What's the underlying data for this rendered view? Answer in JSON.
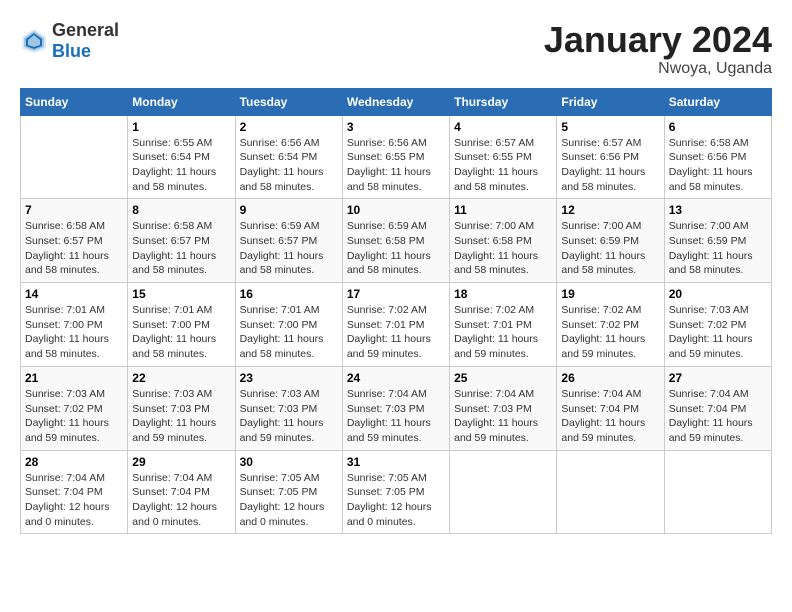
{
  "logo": {
    "general": "General",
    "blue": "Blue"
  },
  "header": {
    "month": "January 2024",
    "location": "Nwoya, Uganda"
  },
  "weekdays": [
    "Sunday",
    "Monday",
    "Tuesday",
    "Wednesday",
    "Thursday",
    "Friday",
    "Saturday"
  ],
  "weeks": [
    [
      {
        "day": "",
        "sunrise": "",
        "sunset": "",
        "daylight": ""
      },
      {
        "day": "1",
        "sunrise": "Sunrise: 6:55 AM",
        "sunset": "Sunset: 6:54 PM",
        "daylight": "Daylight: 11 hours and 58 minutes."
      },
      {
        "day": "2",
        "sunrise": "Sunrise: 6:56 AM",
        "sunset": "Sunset: 6:54 PM",
        "daylight": "Daylight: 11 hours and 58 minutes."
      },
      {
        "day": "3",
        "sunrise": "Sunrise: 6:56 AM",
        "sunset": "Sunset: 6:55 PM",
        "daylight": "Daylight: 11 hours and 58 minutes."
      },
      {
        "day": "4",
        "sunrise": "Sunrise: 6:57 AM",
        "sunset": "Sunset: 6:55 PM",
        "daylight": "Daylight: 11 hours and 58 minutes."
      },
      {
        "day": "5",
        "sunrise": "Sunrise: 6:57 AM",
        "sunset": "Sunset: 6:56 PM",
        "daylight": "Daylight: 11 hours and 58 minutes."
      },
      {
        "day": "6",
        "sunrise": "Sunrise: 6:58 AM",
        "sunset": "Sunset: 6:56 PM",
        "daylight": "Daylight: 11 hours and 58 minutes."
      }
    ],
    [
      {
        "day": "7",
        "sunrise": "Sunrise: 6:58 AM",
        "sunset": "Sunset: 6:57 PM",
        "daylight": "Daylight: 11 hours and 58 minutes."
      },
      {
        "day": "8",
        "sunrise": "Sunrise: 6:58 AM",
        "sunset": "Sunset: 6:57 PM",
        "daylight": "Daylight: 11 hours and 58 minutes."
      },
      {
        "day": "9",
        "sunrise": "Sunrise: 6:59 AM",
        "sunset": "Sunset: 6:57 PM",
        "daylight": "Daylight: 11 hours and 58 minutes."
      },
      {
        "day": "10",
        "sunrise": "Sunrise: 6:59 AM",
        "sunset": "Sunset: 6:58 PM",
        "daylight": "Daylight: 11 hours and 58 minutes."
      },
      {
        "day": "11",
        "sunrise": "Sunrise: 7:00 AM",
        "sunset": "Sunset: 6:58 PM",
        "daylight": "Daylight: 11 hours and 58 minutes."
      },
      {
        "day": "12",
        "sunrise": "Sunrise: 7:00 AM",
        "sunset": "Sunset: 6:59 PM",
        "daylight": "Daylight: 11 hours and 58 minutes."
      },
      {
        "day": "13",
        "sunrise": "Sunrise: 7:00 AM",
        "sunset": "Sunset: 6:59 PM",
        "daylight": "Daylight: 11 hours and 58 minutes."
      }
    ],
    [
      {
        "day": "14",
        "sunrise": "Sunrise: 7:01 AM",
        "sunset": "Sunset: 7:00 PM",
        "daylight": "Daylight: 11 hours and 58 minutes."
      },
      {
        "day": "15",
        "sunrise": "Sunrise: 7:01 AM",
        "sunset": "Sunset: 7:00 PM",
        "daylight": "Daylight: 11 hours and 58 minutes."
      },
      {
        "day": "16",
        "sunrise": "Sunrise: 7:01 AM",
        "sunset": "Sunset: 7:00 PM",
        "daylight": "Daylight: 11 hours and 58 minutes."
      },
      {
        "day": "17",
        "sunrise": "Sunrise: 7:02 AM",
        "sunset": "Sunset: 7:01 PM",
        "daylight": "Daylight: 11 hours and 59 minutes."
      },
      {
        "day": "18",
        "sunrise": "Sunrise: 7:02 AM",
        "sunset": "Sunset: 7:01 PM",
        "daylight": "Daylight: 11 hours and 59 minutes."
      },
      {
        "day": "19",
        "sunrise": "Sunrise: 7:02 AM",
        "sunset": "Sunset: 7:02 PM",
        "daylight": "Daylight: 11 hours and 59 minutes."
      },
      {
        "day": "20",
        "sunrise": "Sunrise: 7:03 AM",
        "sunset": "Sunset: 7:02 PM",
        "daylight": "Daylight: 11 hours and 59 minutes."
      }
    ],
    [
      {
        "day": "21",
        "sunrise": "Sunrise: 7:03 AM",
        "sunset": "Sunset: 7:02 PM",
        "daylight": "Daylight: 11 hours and 59 minutes."
      },
      {
        "day": "22",
        "sunrise": "Sunrise: 7:03 AM",
        "sunset": "Sunset: 7:03 PM",
        "daylight": "Daylight: 11 hours and 59 minutes."
      },
      {
        "day": "23",
        "sunrise": "Sunrise: 7:03 AM",
        "sunset": "Sunset: 7:03 PM",
        "daylight": "Daylight: 11 hours and 59 minutes."
      },
      {
        "day": "24",
        "sunrise": "Sunrise: 7:04 AM",
        "sunset": "Sunset: 7:03 PM",
        "daylight": "Daylight: 11 hours and 59 minutes."
      },
      {
        "day": "25",
        "sunrise": "Sunrise: 7:04 AM",
        "sunset": "Sunset: 7:03 PM",
        "daylight": "Daylight: 11 hours and 59 minutes."
      },
      {
        "day": "26",
        "sunrise": "Sunrise: 7:04 AM",
        "sunset": "Sunset: 7:04 PM",
        "daylight": "Daylight: 11 hours and 59 minutes."
      },
      {
        "day": "27",
        "sunrise": "Sunrise: 7:04 AM",
        "sunset": "Sunset: 7:04 PM",
        "daylight": "Daylight: 11 hours and 59 minutes."
      }
    ],
    [
      {
        "day": "28",
        "sunrise": "Sunrise: 7:04 AM",
        "sunset": "Sunset: 7:04 PM",
        "daylight": "Daylight: 12 hours and 0 minutes."
      },
      {
        "day": "29",
        "sunrise": "Sunrise: 7:04 AM",
        "sunset": "Sunset: 7:04 PM",
        "daylight": "Daylight: 12 hours and 0 minutes."
      },
      {
        "day": "30",
        "sunrise": "Sunrise: 7:05 AM",
        "sunset": "Sunset: 7:05 PM",
        "daylight": "Daylight: 12 hours and 0 minutes."
      },
      {
        "day": "31",
        "sunrise": "Sunrise: 7:05 AM",
        "sunset": "Sunset: 7:05 PM",
        "daylight": "Daylight: 12 hours and 0 minutes."
      },
      {
        "day": "",
        "sunrise": "",
        "sunset": "",
        "daylight": ""
      },
      {
        "day": "",
        "sunrise": "",
        "sunset": "",
        "daylight": ""
      },
      {
        "day": "",
        "sunrise": "",
        "sunset": "",
        "daylight": ""
      }
    ]
  ]
}
